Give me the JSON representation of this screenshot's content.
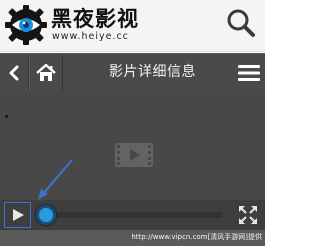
{
  "header": {
    "logo_title": "黑夜影视",
    "logo_url": "www.heiye.cc",
    "logo_icon": "eye-gear-logo",
    "search_icon": "search-icon"
  },
  "navbar": {
    "back_icon": "chevron-left-icon",
    "home_icon": "home-icon",
    "title": "影片详细信息",
    "menu_icon": "hamburger-menu-icon"
  },
  "player": {
    "placeholder_icon": "film-icon",
    "play_icon": "play-icon",
    "fullscreen_icon": "fullscreen-icon",
    "progress_fraction": 0.1,
    "annotation_arrow_color": "#3b74d0",
    "accent_color": "#2a9ad8"
  },
  "watermark": "http://www.vipcn.com[清风手游网]提供"
}
